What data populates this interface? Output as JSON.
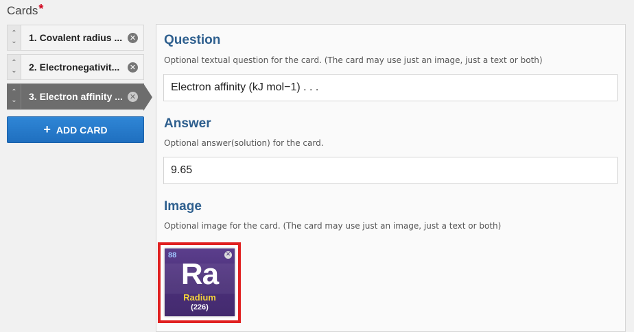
{
  "header": {
    "title": "Cards",
    "required_mark": "*"
  },
  "cards": [
    {
      "label": "1. Covalent radius ...",
      "remove_icon": "close-circle-icon"
    },
    {
      "label": "2. Electronegativit...",
      "remove_icon": "close-circle-icon"
    },
    {
      "label": "3. Electron affinity ...",
      "remove_icon": "close-circle-icon",
      "active": true
    }
  ],
  "reorder_glyphs": {
    "up": "⌃",
    "down": "⌄"
  },
  "add_card": {
    "icon": "+",
    "label": "ADD CARD"
  },
  "question": {
    "title": "Question",
    "description": "Optional textual question for the card. (The card may use just an image, just a text or both)",
    "value": "Electron affinity (kJ mol−1)  . . ."
  },
  "answer": {
    "title": "Answer",
    "description": "Optional answer(solution) for the card.",
    "value": "9.65"
  },
  "image": {
    "title": "Image",
    "description": "Optional image for the card. (The card may use just an image, just a text or both)",
    "element": {
      "atomic_number": "88",
      "symbol": "Ra",
      "name": "Radium",
      "mass": "(226)"
    },
    "remove_glyph": "✕",
    "colors": {
      "frame": "#e02020",
      "tile": "#4a2f78",
      "name": "#f2d23a"
    }
  },
  "colors": {
    "accent": "#1f6fbf",
    "section_title": "#2e5f8e",
    "active_tab": "#6d6d6d"
  }
}
